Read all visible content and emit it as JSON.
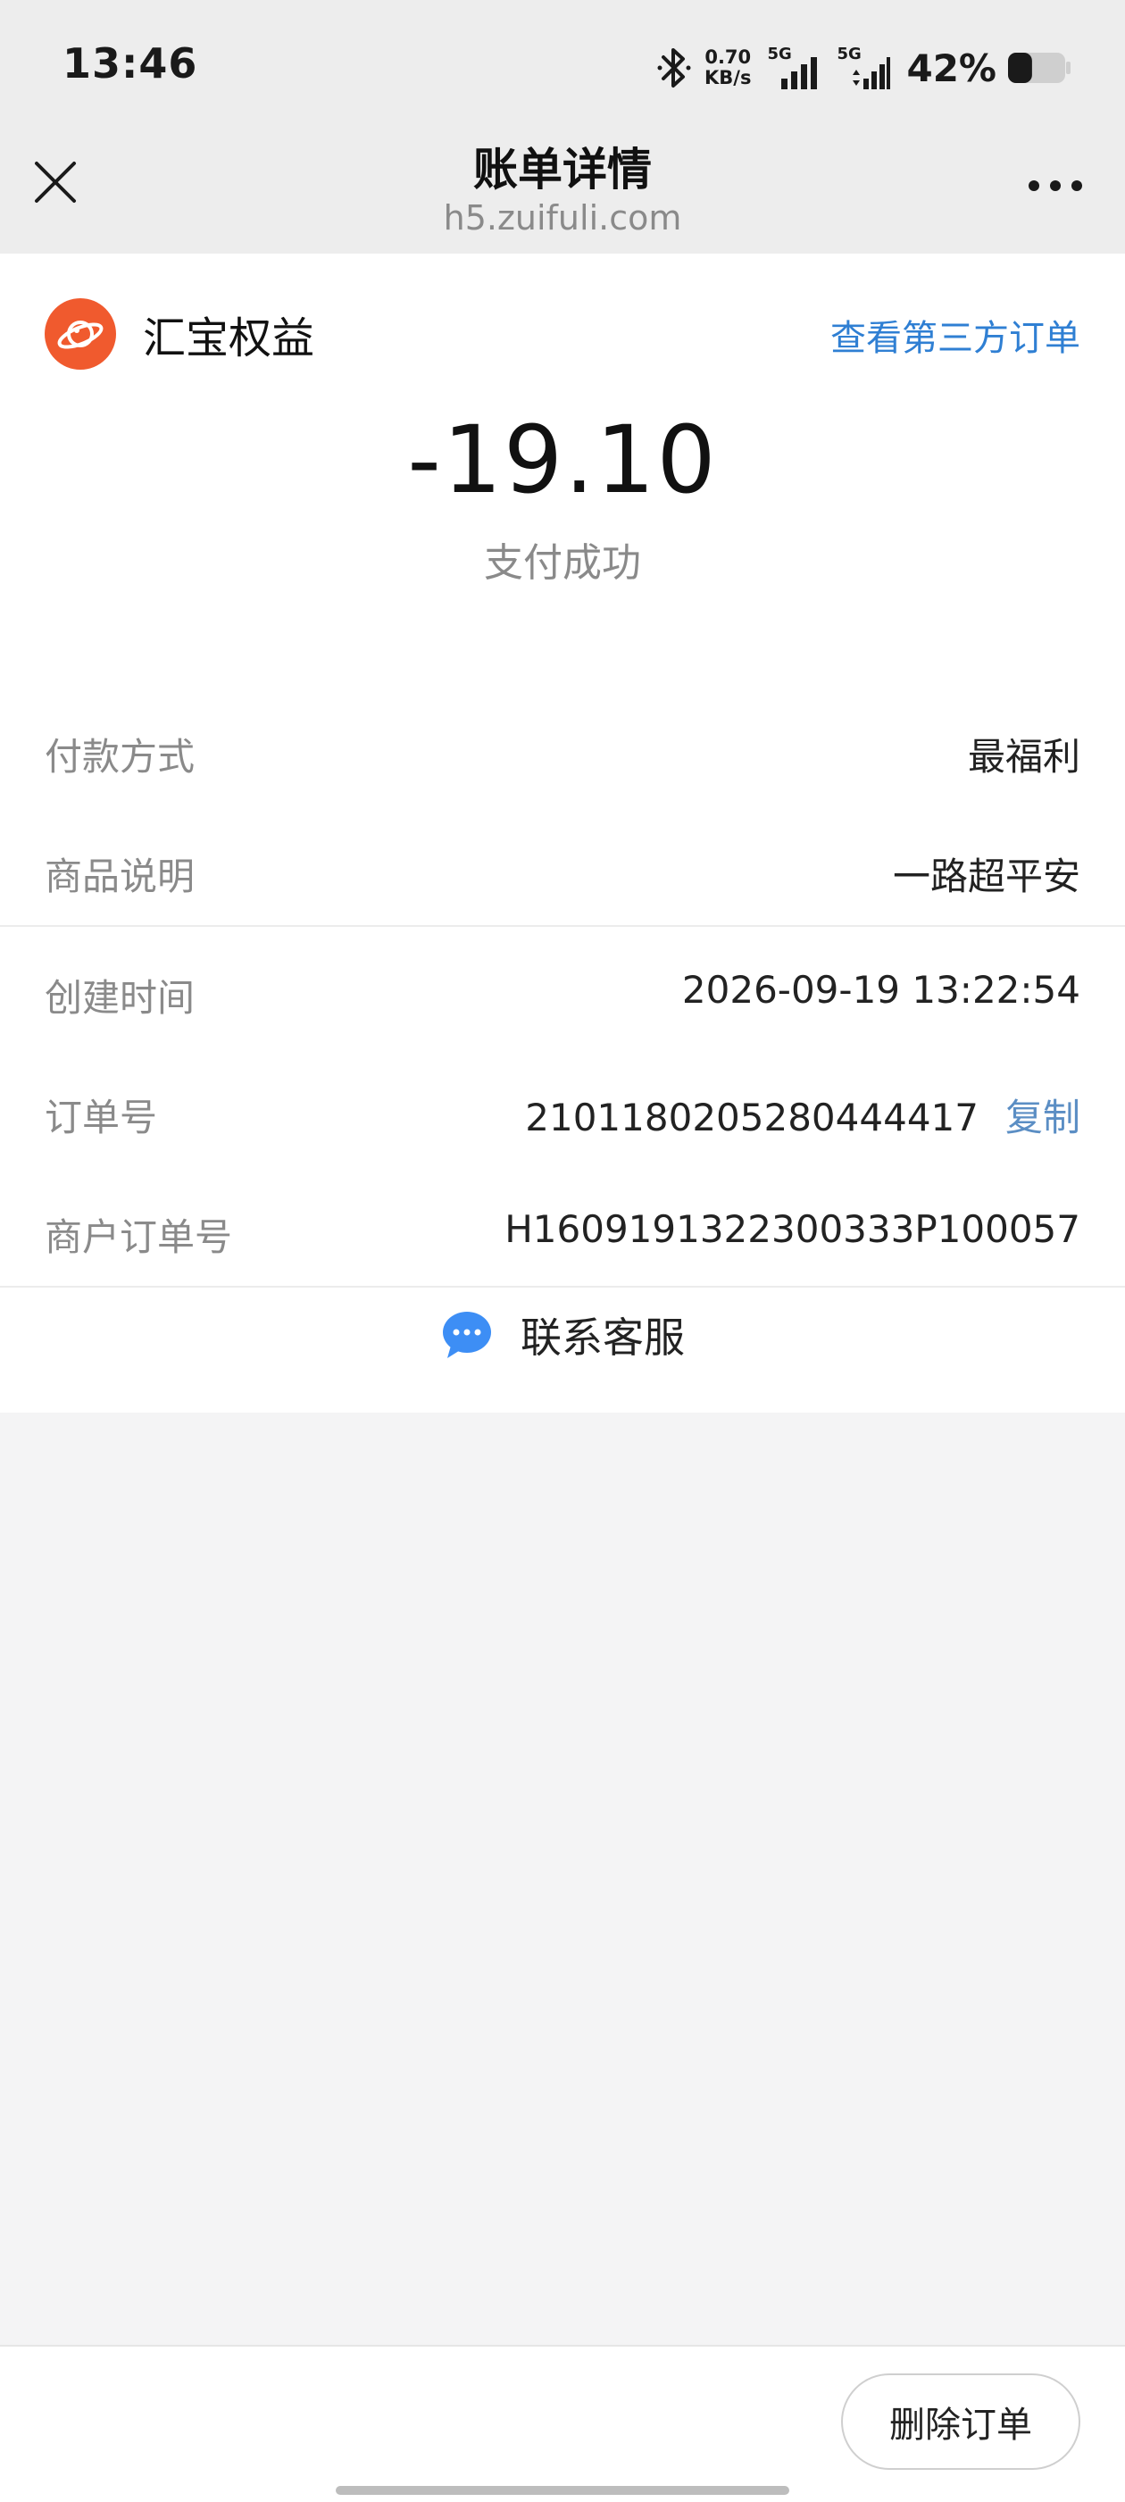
{
  "status_bar": {
    "time": "13:46",
    "net_speed_value": "0.70",
    "net_speed_unit": "KB/s",
    "sim1_label": "5G",
    "sim2_label": "5G",
    "battery_percent": "42%",
    "battery_level": 0.42
  },
  "nav": {
    "title": "账单详情",
    "url": "h5.zuifuli.com"
  },
  "merchant": {
    "name": "汇宝权益",
    "third_party_link": "查看第三方订单",
    "logo_color": "#f05a2e"
  },
  "payment": {
    "amount": "-19.10",
    "status": "支付成功"
  },
  "details": {
    "payment_method": {
      "label": "付款方式",
      "value": "最福利"
    },
    "product_desc": {
      "label": "商品说明",
      "value": "一路超平安"
    },
    "created_time": {
      "label": "创建时间",
      "value": "2026-09-19 13:22:54"
    },
    "order_no": {
      "label": "订单号",
      "value": "2101180205280444417",
      "copy_label": "复制"
    },
    "merchant_order_no": {
      "label": "商户订单号",
      "value": "H1609191322300333P100057"
    }
  },
  "contact": {
    "label": "联系客服"
  },
  "footer": {
    "delete_label": "删除订单"
  },
  "colors": {
    "link_blue": "#2f7fd3",
    "copy_blue": "#5b8ec4",
    "page_bg": "#f4f4f5"
  }
}
